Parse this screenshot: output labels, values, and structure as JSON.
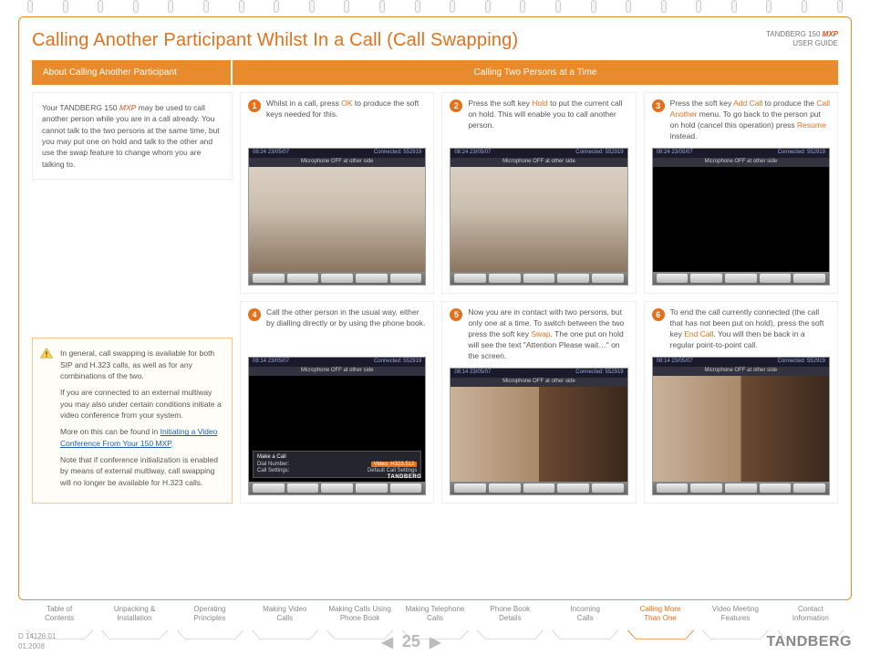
{
  "product": {
    "name": "TANDBERG 150",
    "suffix": "MXP",
    "sub": "USER GUIDE"
  },
  "title": "Calling Another Participant Whilst In a Call (Call Swapping)",
  "bar": {
    "left": "About Calling Another Participant",
    "right": "Calling Two Persons at a Time"
  },
  "intro": {
    "prefix": "Your TANDBERG 150",
    "mxp": "MXP",
    "rest": " may be used to call another person while you are in a call already. You cannot talk to the two persons at the same time, but you may put one on hold and talk to the other and use the swap feature to change whom you are talking to."
  },
  "info": {
    "p1": "In general, call swapping is available for both SIP and H.323 calls, as well as for any combinations of the two.",
    "p2": "If you are connected to an external multiway you may also under certain conditions initiate a video conference from your system.",
    "p3a": "More on this can be found in ",
    "p3link": "Initiating a Video Conference From Your 150 MXP",
    "p3b": ".",
    "p4": "Note that if conference initialization is enabled by means of external multiway, call swapping will no longer be available for H.323 calls."
  },
  "steps": [
    {
      "n": "1",
      "pre": "Whilst in a call, press ",
      "kw": "OK",
      "post": " to produce the soft keys needed for this.",
      "img": "photo"
    },
    {
      "n": "2",
      "pre": "Press the soft key ",
      "kw": "Hold",
      "post": " to put the current call on hold. This will enable you to call another person.",
      "img": "photo"
    },
    {
      "n": "3",
      "pre": "Press the soft key ",
      "kw": "Add Call",
      "post": " to produce the ",
      "kw2": "Call Another",
      "post2": " menu. To go back to the person put on hold (cancel this operation) press ",
      "kw3": "Resume",
      "post3": " instead.",
      "img": "dark"
    },
    {
      "n": "4",
      "pre": "Call the other person in the usual way, either by dialling directly or by using the phone book.",
      "kw": "",
      "post": "",
      "img": "dial"
    },
    {
      "n": "5",
      "pre": "Now you are in contact with two persons, but only one at a time. To switch between the two press the soft key ",
      "kw": "Swap",
      "post": ". The one put on hold will see the text \"Attention Please wait…\" on the screen.",
      "img": "two"
    },
    {
      "n": "6",
      "pre": "To end the call currently connected (the call that has not been put on hold), press the soft key ",
      "kw": "End Call",
      "post": ". You will then be back in a regular point-to-point call.",
      "img": "two"
    }
  ],
  "screen": {
    "time": "08:24  23/05/07",
    "time2": "08:14  23/05/07",
    "conn": "Connected: 552919",
    "mic": "Microphone OFF at other side",
    "dial_title": "Make a Call",
    "dial_l1": "Dial Number:",
    "dial_r1": "Video: H323.512",
    "dial_l2": "Call Settings:",
    "dial_r2": "Default Call Settings",
    "brand": "TANDBERG"
  },
  "tabs": [
    "Table of Contents",
    "Unpacking & Installation",
    "Operating Principles",
    "Making Video Calls",
    "Making Calls Using Phone Book",
    "Making Telephone Calls",
    "Phone Book Details",
    "Incoming Calls",
    "Calling More Than One",
    "Video Meeting Features",
    "Contact Information"
  ],
  "active_tab": 8,
  "page_number": "25",
  "doc": {
    "id": "D 14126.01",
    "date": "01.2008"
  },
  "brand": "TANDBERG"
}
